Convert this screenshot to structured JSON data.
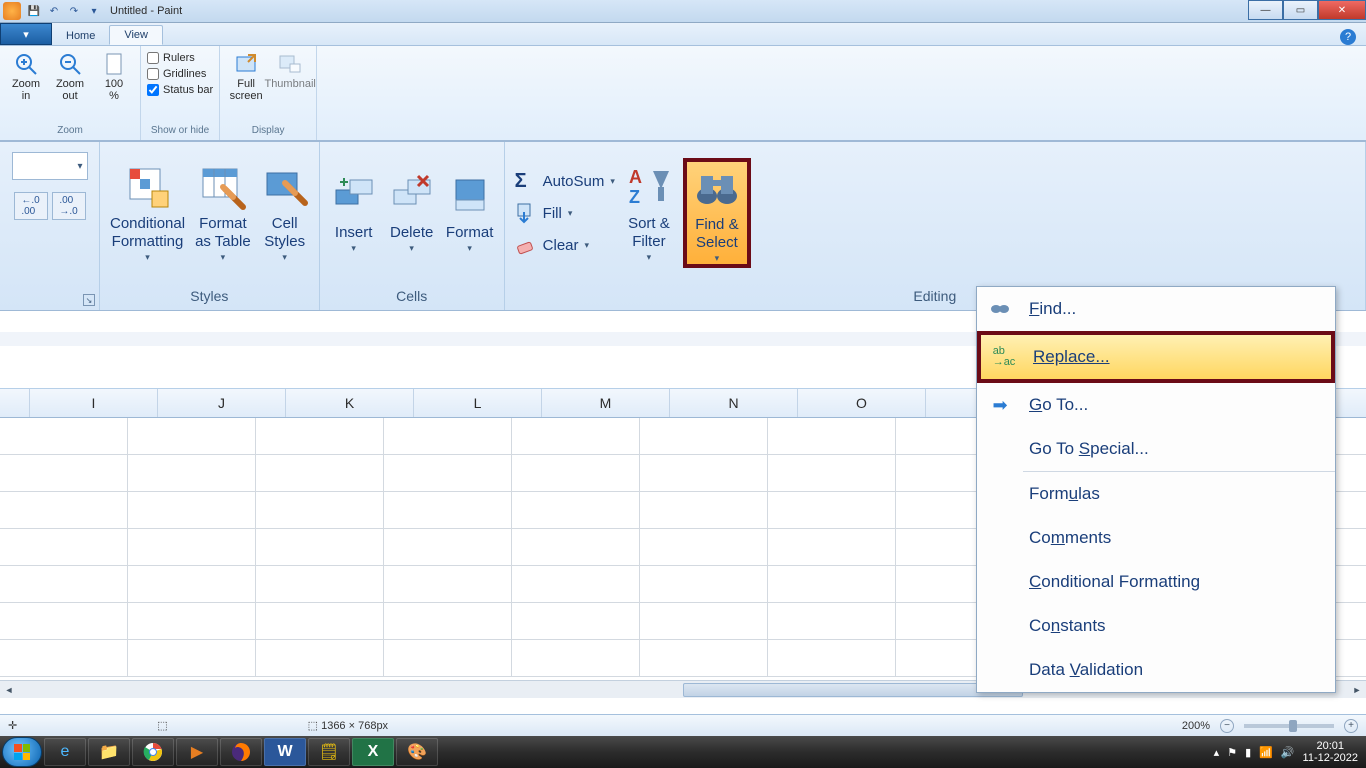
{
  "titlebar": {
    "title": "Untitled - Paint"
  },
  "paint_tabs": {
    "file": "",
    "home": "Home",
    "view": "View"
  },
  "paint_view": {
    "zoom_in": "Zoom\nin",
    "zoom_out": "Zoom\nout",
    "zoom_100": "100\n%",
    "zoom_label": "Zoom",
    "rulers": "Rulers",
    "gridlines": "Gridlines",
    "statusbar": "Status bar",
    "show_label": "Show or hide",
    "fullscreen": "Full\nscreen",
    "thumbnail": "Thumbnail",
    "display_label": "Display"
  },
  "excel": {
    "cond_fmt": "Conditional\nFormatting",
    "fmt_table": "Format\nas Table",
    "cell_styles": "Cell\nStyles",
    "styles_label": "Styles",
    "insert": "Insert",
    "delete": "Delete",
    "format": "Format",
    "cells_label": "Cells",
    "autosum": "AutoSum",
    "fill": "Fill",
    "clear": "Clear",
    "sort_filter": "Sort &\nFilter",
    "find_select": "Find &\nSelect",
    "editing_label": "Editing"
  },
  "dropdown": {
    "find": "Find...",
    "replace": "Replace...",
    "goto": "Go To...",
    "goto_special": "Go To Special...",
    "formulas": "Formulas",
    "comments": "Comments",
    "cond_fmt": "Conditional Formatting",
    "constants": "Constants",
    "data_val": "Data Validation"
  },
  "columns": [
    "I",
    "J",
    "K",
    "L",
    "M",
    "N",
    "O"
  ],
  "status": {
    "dims": "1366 × 768px",
    "zoom": "200%"
  },
  "tray": {
    "time": "20:01",
    "date": "11-12-2022"
  }
}
